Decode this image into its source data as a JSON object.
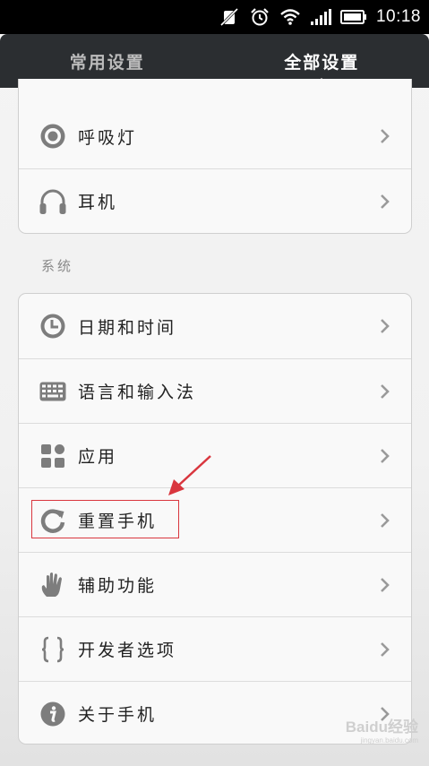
{
  "status_bar": {
    "time": "10:18",
    "icons": [
      "vibrate-off-icon",
      "alarm-icon",
      "wifi-icon",
      "signal-icon",
      "battery-icon"
    ]
  },
  "tabs": [
    {
      "label": "常用设置",
      "active": false
    },
    {
      "label": "全部设置",
      "active": true
    }
  ],
  "top_group": {
    "items": [
      {
        "label": "呼吸灯",
        "icon": "breathing-light-icon"
      },
      {
        "label": "耳机",
        "icon": "headphones-icon"
      }
    ]
  },
  "system_section": {
    "title": "系统",
    "items": [
      {
        "label": "日期和时间",
        "icon": "clock-icon"
      },
      {
        "label": "语言和输入法",
        "icon": "keyboard-icon"
      },
      {
        "label": "应用",
        "icon": "apps-icon"
      },
      {
        "label": "重置手机",
        "icon": "reset-icon"
      },
      {
        "label": "辅助功能",
        "icon": "hand-icon"
      },
      {
        "label": "开发者选项",
        "icon": "braces-icon"
      },
      {
        "label": "关于手机",
        "icon": "info-icon"
      }
    ]
  },
  "watermark": {
    "text": "Baidu经验",
    "sub": "jingyan.baidu.com"
  },
  "colors": {
    "tab_bar": "#2b2e31",
    "annotation": "#d9363e",
    "icon_gray": "#8a8a8a"
  }
}
